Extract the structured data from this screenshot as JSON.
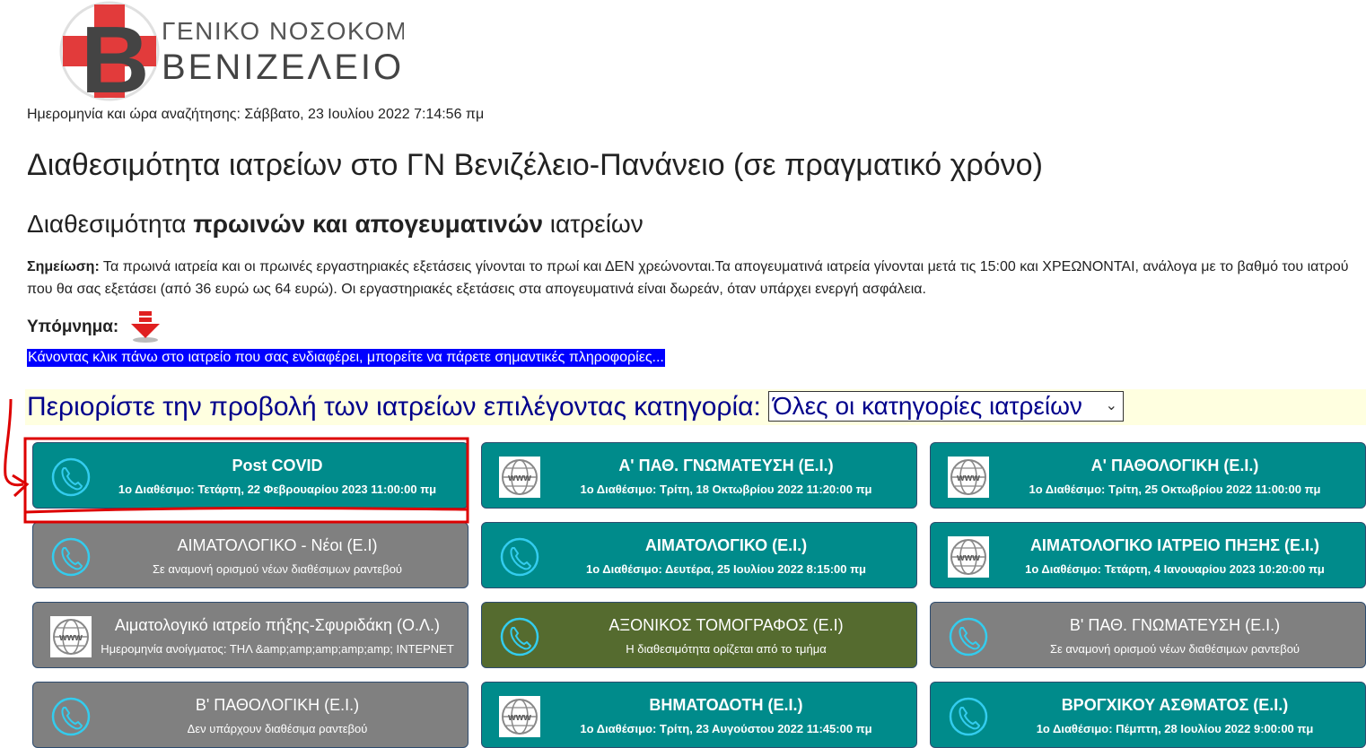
{
  "logo": {
    "line1": "ΓΕΝΙΚΟ ΝΟΣΟΚΟΜΕΙΟ",
    "line2": "ΒΕΝΙΖΕΛΕΙΟ"
  },
  "search_datetime": "Ημερομηνία και ώρα αναζήτησης: Σάββατο, 23 Ιουλίου 2022 7:14:56 πμ",
  "main_title": "Διαθεσιμότητα ιατρείων στο ΓΝ Βενιζέλειο-Πανάνειο (σε πραγματικό χρόνο)",
  "sub_title": {
    "pre": "Διαθεσιμότητα ",
    "bold": "πρωινών και απογευματινών",
    "post": " ιατρείων"
  },
  "note": {
    "label": "Σημείωση:",
    "text": " Τα πρωινά ιατρεία και οι πρωινές εργαστηριακές εξετάσεις γίνονται το πρωί και ΔΕΝ χρεώνονται.Τα απογευματινά ιατρεία γίνονται μετά τις 15:00 και ΧΡΕΩΝΟΝΤΑΙ, ανάλογα με το βαθμό του ιατρού που θα σας εξετάσει (από 36 ευρώ ως 64 ευρώ). Οι εργαστηριακές εξετάσεις στα απογευματινά είναι δωρεάν, όταν υπάρχει ενεργή ασφάλεια."
  },
  "legend_label": "Υπόμνημα:",
  "hint": "Κάνοντας κλικ πάνω στο ιατρείο που σας ενδιαφέρει, μπορείτε να πάρετε σημαντικές πληροφορίες...",
  "filter": {
    "label": "Περιορίστε την προβολή των ιατρείων επιλέγοντας κατηγορία:",
    "selected": "Όλες οι κατηγορίες ιατρείων"
  },
  "colors": {
    "teal": "#008b8b",
    "gray": "#808080",
    "olive": "#556b2f",
    "annotation": "#dd0000"
  },
  "clinics": [
    {
      "title": "Post COVID",
      "subtitle": "1ο Διαθέσιμο: Τετάρτη, 22 Φεβρουαρίου 2023 11:00:00 πμ",
      "color": "teal",
      "icon": "phone-icon"
    },
    {
      "title": "Α' ΠΑΘ. ΓΝΩΜΑΤΕΥΣΗ (Ε.Ι.)",
      "subtitle": "1ο Διαθέσιμο: Τρίτη, 18 Οκτωβρίου 2022 11:20:00 πμ",
      "color": "teal",
      "icon": "www-icon"
    },
    {
      "title": "Α' ΠΑΘΟΛΟΓΙΚΗ (Ε.Ι.)",
      "subtitle": "1ο Διαθέσιμο: Τρίτη, 25 Οκτωβρίου 2022 11:00:00 πμ",
      "color": "teal",
      "icon": "www-icon"
    },
    {
      "title": "ΑΙΜΑΤΟΛΟΓΙΚΟ - Νέοι (Ε.Ι)",
      "subtitle": "Σε αναμονή ορισμού νέων διαθέσιμων ραντεβού",
      "color": "gray",
      "icon": "phone-icon"
    },
    {
      "title": "ΑΙΜΑΤΟΛΟΓΙΚΟ (Ε.Ι.)",
      "subtitle": "1ο Διαθέσιμο: Δευτέρα, 25 Ιουλίου 2022 8:15:00 πμ",
      "color": "teal",
      "icon": "phone-icon"
    },
    {
      "title": "ΑΙΜΑΤΟΛΟΓΙΚΟ ΙΑΤΡΕΙΟ ΠΗΞΗΣ (Ε.Ι.)",
      "subtitle": "1ο Διαθέσιμο: Τετάρτη, 4 Ιανουαρίου 2023 10:20:00 πμ",
      "color": "teal",
      "icon": "www-icon"
    },
    {
      "title": "Αιματολογικό ιατρείο πήξης-Σφυριδάκη (Ο.Λ.)",
      "subtitle": "Ημερομηνία ανοίγματος: ΤΗΛ &amp;amp;amp;amp;amp; ΙΝΤΕΡΝΕΤ",
      "color": "gray",
      "icon": "www-icon"
    },
    {
      "title": "ΑΞΟΝΙΚΟΣ ΤΟΜΟΓΡΑΦΟΣ (Ε.Ι)",
      "subtitle": "Η διαθεσιμότητα ορίζεται από το τμήμα",
      "color": "olive",
      "icon": "phone-icon"
    },
    {
      "title": "Β' ΠΑΘ. ΓΝΩΜΑΤΕΥΣΗ (Ε.Ι.)",
      "subtitle": "Σε αναμονή ορισμού νέων διαθέσιμων ραντεβού",
      "color": "gray",
      "icon": "phone-icon"
    },
    {
      "title": "Β' ΠΑΘΟΛΟΓΙΚΗ (Ε.Ι.)",
      "subtitle": "Δεν υπάρχουν διαθέσιμα ραντεβού",
      "color": "gray",
      "icon": "phone-icon"
    },
    {
      "title": "ΒΗΜΑΤΟΔΟΤΗ (Ε.Ι.)",
      "subtitle": "1ο Διαθέσιμο: Τρίτη, 23 Αυγούστου 2022 11:45:00 πμ",
      "color": "teal",
      "icon": "www-icon"
    },
    {
      "title": "ΒΡΟΓΧΙΚΟΥ ΑΣΘΜΑΤΟΣ (Ε.Ι.)",
      "subtitle": "1ο Διαθέσιμο: Πέμπτη, 28 Ιουλίου 2022 9:00:00 πμ",
      "color": "teal",
      "icon": "phone-icon"
    }
  ]
}
